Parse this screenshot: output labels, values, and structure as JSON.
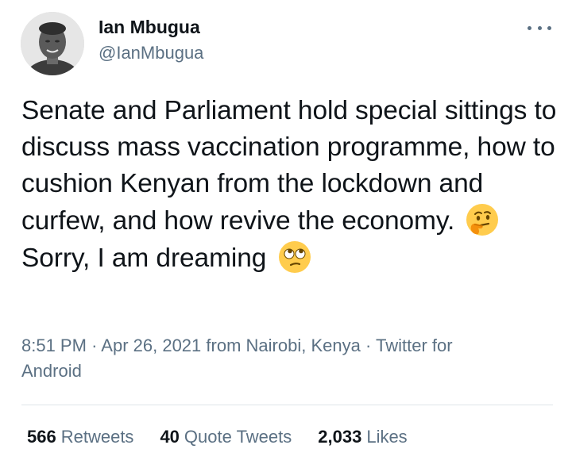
{
  "author": {
    "name": "Ian Mbugua",
    "handle": "@IanMbugua"
  },
  "tweet": {
    "text_part1": "Senate and Parliament hold special sittings to discuss mass vaccination programme, how to cushion Kenyan from the lockdown and curfew, and how revive the economy.",
    "emoji1": "thinking-face-icon",
    "text_part2": "Sorry, I am dreaming",
    "emoji2": "face-with-rolling-eyes-icon"
  },
  "meta": {
    "time": "8:51 PM",
    "date": "Apr 26, 2021",
    "location_prefix": "from",
    "location": "Nairobi, Kenya",
    "client": "Twitter for Android",
    "separator": "·"
  },
  "stats": {
    "retweets_count": "566",
    "retweets_label": "Retweets",
    "quotes_count": "40",
    "quotes_label": "Quote Tweets",
    "likes_count": "2,033",
    "likes_label": "Likes"
  },
  "colors": {
    "text": "#0f1419",
    "secondary": "#5b7083",
    "divider": "#dfe5e9"
  }
}
